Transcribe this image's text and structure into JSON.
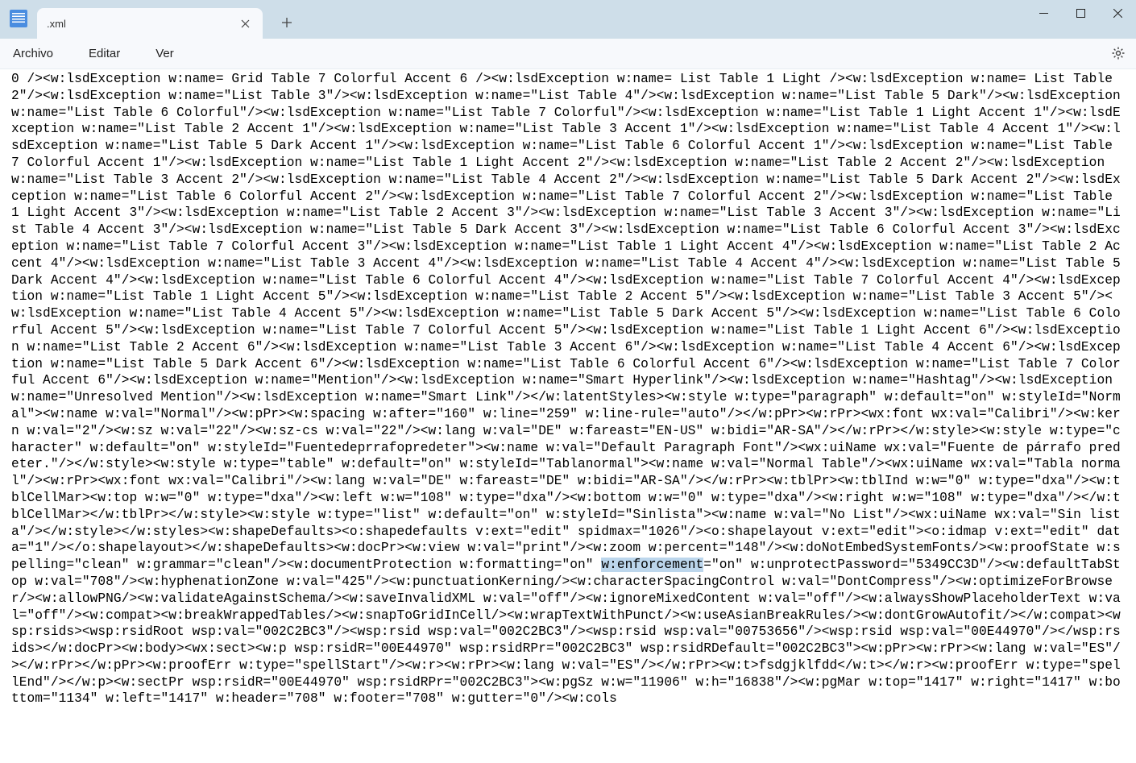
{
  "tab": {
    "title": "         .xml"
  },
  "menu": {
    "archivo": "Archivo",
    "editar": "Editar",
    "ver": "Ver"
  },
  "editor": {
    "before": "0 /><w:lsdException w:name= Grid Table 7 Colorful Accent 6 /><w:lsdException w:name= List Table 1 Light /><w:lsdException w:name= List Table 2\"/><w:lsdException w:name=\"List Table 3\"/><w:lsdException w:name=\"List Table 4\"/><w:lsdException w:name=\"List Table 5 Dark\"/><w:lsdException w:name=\"List Table 6 Colorful\"/><w:lsdException w:name=\"List Table 7 Colorful\"/><w:lsdException w:name=\"List Table 1 Light Accent 1\"/><w:lsdException w:name=\"List Table 2 Accent 1\"/><w:lsdException w:name=\"List Table 3 Accent 1\"/><w:lsdException w:name=\"List Table 4 Accent 1\"/><w:lsdException w:name=\"List Table 5 Dark Accent 1\"/><w:lsdException w:name=\"List Table 6 Colorful Accent 1\"/><w:lsdException w:name=\"List Table 7 Colorful Accent 1\"/><w:lsdException w:name=\"List Table 1 Light Accent 2\"/><w:lsdException w:name=\"List Table 2 Accent 2\"/><w:lsdException w:name=\"List Table 3 Accent 2\"/><w:lsdException w:name=\"List Table 4 Accent 2\"/><w:lsdException w:name=\"List Table 5 Dark Accent 2\"/><w:lsdException w:name=\"List Table 6 Colorful Accent 2\"/><w:lsdException w:name=\"List Table 7 Colorful Accent 2\"/><w:lsdException w:name=\"List Table 1 Light Accent 3\"/><w:lsdException w:name=\"List Table 2 Accent 3\"/><w:lsdException w:name=\"List Table 3 Accent 3\"/><w:lsdException w:name=\"List Table 4 Accent 3\"/><w:lsdException w:name=\"List Table 5 Dark Accent 3\"/><w:lsdException w:name=\"List Table 6 Colorful Accent 3\"/><w:lsdException w:name=\"List Table 7 Colorful Accent 3\"/><w:lsdException w:name=\"List Table 1 Light Accent 4\"/><w:lsdException w:name=\"List Table 2 Accent 4\"/><w:lsdException w:name=\"List Table 3 Accent 4\"/><w:lsdException w:name=\"List Table 4 Accent 4\"/><w:lsdException w:name=\"List Table 5 Dark Accent 4\"/><w:lsdException w:name=\"List Table 6 Colorful Accent 4\"/><w:lsdException w:name=\"List Table 7 Colorful Accent 4\"/><w:lsdException w:name=\"List Table 1 Light Accent 5\"/><w:lsdException w:name=\"List Table 2 Accent 5\"/><w:lsdException w:name=\"List Table 3 Accent 5\"/><w:lsdException w:name=\"List Table 4 Accent 5\"/><w:lsdException w:name=\"List Table 5 Dark Accent 5\"/><w:lsdException w:name=\"List Table 6 Colorful Accent 5\"/><w:lsdException w:name=\"List Table 7 Colorful Accent 5\"/><w:lsdException w:name=\"List Table 1 Light Accent 6\"/><w:lsdException w:name=\"List Table 2 Accent 6\"/><w:lsdException w:name=\"List Table 3 Accent 6\"/><w:lsdException w:name=\"List Table 4 Accent 6\"/><w:lsdException w:name=\"List Table 5 Dark Accent 6\"/><w:lsdException w:name=\"List Table 6 Colorful Accent 6\"/><w:lsdException w:name=\"List Table 7 Colorful Accent 6\"/><w:lsdException w:name=\"Mention\"/><w:lsdException w:name=\"Smart Hyperlink\"/><w:lsdException w:name=\"Hashtag\"/><w:lsdException w:name=\"Unresolved Mention\"/><w:lsdException w:name=\"Smart Link\"/></w:latentStyles><w:style w:type=\"paragraph\" w:default=\"on\" w:styleId=\"Normal\"><w:name w:val=\"Normal\"/><w:pPr><w:spacing w:after=\"160\" w:line=\"259\" w:line-rule=\"auto\"/></w:pPr><w:rPr><wx:font wx:val=\"Calibri\"/><w:kern w:val=\"2\"/><w:sz w:val=\"22\"/><w:sz-cs w:val=\"22\"/><w:lang w:val=\"DE\" w:fareast=\"EN-US\" w:bidi=\"AR-SA\"/></w:rPr></w:style><w:style w:type=\"character\" w:default=\"on\" w:styleId=\"Fuentedeprrafopredeter\"><w:name w:val=\"Default Paragraph Font\"/><wx:uiName wx:val=\"Fuente de párrafo predeter.\"/></w:style><w:style w:type=\"table\" w:default=\"on\" w:styleId=\"Tablanormal\"><w:name w:val=\"Normal Table\"/><wx:uiName wx:val=\"Tabla normal\"/><w:rPr><wx:font wx:val=\"Calibri\"/><w:lang w:val=\"DE\" w:fareast=\"DE\" w:bidi=\"AR-SA\"/></w:rPr><w:tblPr><w:tblInd w:w=\"0\" w:type=\"dxa\"/><w:tblCellMar><w:top w:w=\"0\" w:type=\"dxa\"/><w:left w:w=\"108\" w:type=\"dxa\"/><w:bottom w:w=\"0\" w:type=\"dxa\"/><w:right w:w=\"108\" w:type=\"dxa\"/></w:tblCellMar></w:tblPr></w:style><w:style w:type=\"list\" w:default=\"on\" w:styleId=\"Sinlista\"><w:name w:val=\"No List\"/><wx:uiName wx:val=\"Sin lista\"/></w:style></w:styles><w:shapeDefaults><o:shapedefaults v:ext=\"edit\" spidmax=\"1026\"/><o:shapelayout v:ext=\"edit\"><o:idmap v:ext=\"edit\" data=\"1\"/></o:shapelayout></w:shapeDefaults><w:docPr><w:view w:val=\"print\"/><w:zoom w:percent=\"148\"/><w:doNotEmbedSystemFonts/><w:proofState w:spelling=\"clean\" w:grammar=\"clean\"/><w:documentProtection w:formatting=\"on\" ",
    "highlight": "w:enforcement",
    "after": "=\"on\" w:unprotectPassword=\"5349CC3D\"/><w:defaultTabStop w:val=\"708\"/><w:hyphenationZone w:val=\"425\"/><w:punctuationKerning/><w:characterSpacingControl w:val=\"DontCompress\"/><w:optimizeForBrowser/><w:allowPNG/><w:validateAgainstSchema/><w:saveInvalidXML w:val=\"off\"/><w:ignoreMixedContent w:val=\"off\"/><w:alwaysShowPlaceholderText w:val=\"off\"/><w:compat><w:breakWrappedTables/><w:snapToGridInCell/><w:wrapTextWithPunct/><w:useAsianBreakRules/><w:dontGrowAutofit/></w:compat><wsp:rsids><wsp:rsidRoot wsp:val=\"002C2BC3\"/><wsp:rsid wsp:val=\"002C2BC3\"/><wsp:rsid wsp:val=\"00753656\"/><wsp:rsid wsp:val=\"00E44970\"/></wsp:rsids></w:docPr><w:body><wx:sect><w:p wsp:rsidR=\"00E44970\" wsp:rsidRPr=\"002C2BC3\" wsp:rsidRDefault=\"002C2BC3\"><w:pPr><w:rPr><w:lang w:val=\"ES\"/></w:rPr></w:pPr><w:proofErr w:type=\"spellStart\"/><w:r><w:rPr><w:lang w:val=\"ES\"/></w:rPr><w:t>fsdgjklfdd</w:t></w:r><w:proofErr w:type=\"spellEnd\"/></w:p><w:sectPr wsp:rsidR=\"00E44970\" wsp:rsidRPr=\"002C2BC3\"><w:pgSz w:w=\"11906\" w:h=\"16838\"/><w:pgMar w:top=\"1417\" w:right=\"1417\" w:bottom=\"1134\" w:left=\"1417\" w:header=\"708\" w:footer=\"708\" w:gutter=\"0\"/><w:cols"
  }
}
